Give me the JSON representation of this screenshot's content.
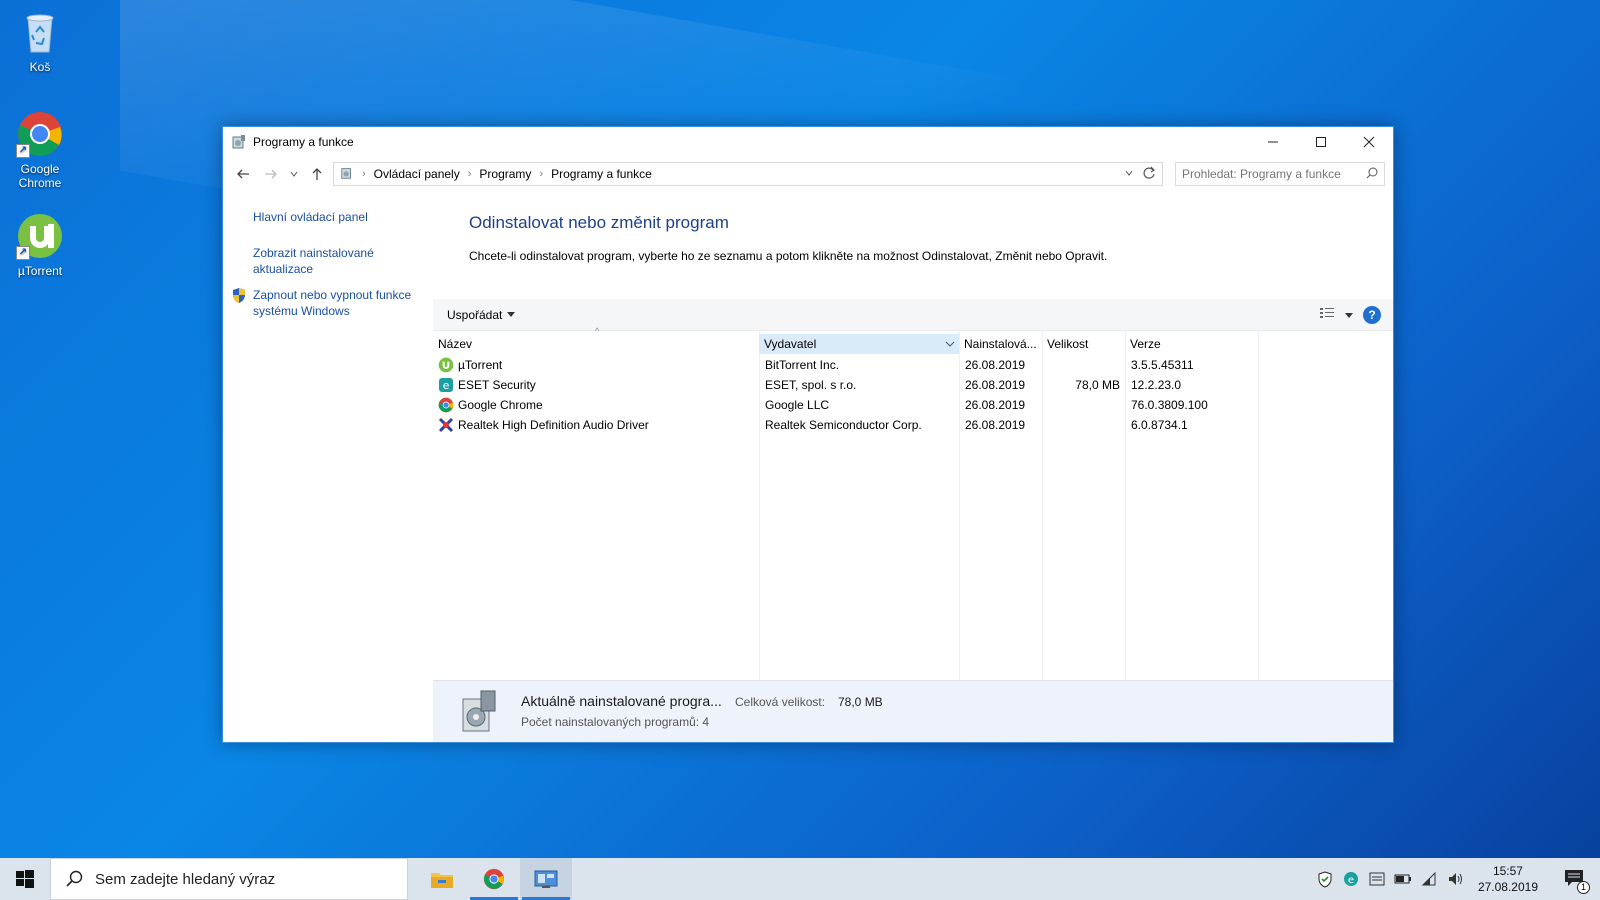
{
  "desktop": {
    "icons": [
      {
        "label": "Koš"
      },
      {
        "label": "Google Chrome"
      },
      {
        "label": "µTorrent"
      }
    ]
  },
  "window": {
    "title": "Programy a funkce",
    "controls": {
      "minimize": "—",
      "maximize": "☐",
      "close": "✕"
    },
    "breadcrumb": [
      "Ovládací panely",
      "Programy",
      "Programy a funkce"
    ],
    "search_placeholder": "Prohledat: Programy a funkce"
  },
  "left_pane": {
    "home_link": "Hlavní ovládací panel",
    "updates_link_line1": "Zobrazit nainstalované",
    "updates_link_line2": "aktualizace",
    "features_link_line1": "Zapnout nebo vypnout funkce",
    "features_link_line2": "systému Windows"
  },
  "main": {
    "heading": "Odinstalovat nebo změnit program",
    "description": "Chcete-li odinstalovat program, vyberte ho ze seznamu a potom klikněte na možnost Odinstalovat, Změnit nebo Opravit.",
    "organize_label": "Uspořádat",
    "columns": {
      "name": "Název",
      "publisher": "Vydavatel",
      "installed": "Nainstalová...",
      "size": "Velikost",
      "version": "Verze"
    },
    "programs": [
      {
        "name": "µTorrent",
        "publisher": "BitTorrent Inc.",
        "installed": "26.08.2019",
        "size": "",
        "version": "3.5.5.45311",
        "icon": "utorrent-icon"
      },
      {
        "name": "ESET Security",
        "publisher": "ESET, spol. s r.o.",
        "installed": "26.08.2019",
        "size": "78,0 MB",
        "version": "12.2.23.0",
        "icon": "eset-icon"
      },
      {
        "name": "Google Chrome",
        "publisher": "Google LLC",
        "installed": "26.08.2019",
        "size": "",
        "version": "76.0.3809.100",
        "icon": "chrome-icon"
      },
      {
        "name": "Realtek High Definition Audio Driver",
        "publisher": "Realtek Semiconductor Corp.",
        "installed": "26.08.2019",
        "size": "",
        "version": "6.0.8734.1",
        "icon": "realtek-icon"
      }
    ]
  },
  "details": {
    "title": "Aktuálně nainstalované progra...",
    "total_size_label": "Celková velikost:",
    "total_size": "78,0 MB",
    "count_text": "Počet nainstalovaných programů: 4"
  },
  "taskbar": {
    "search_placeholder": "Sem zadejte hledaný výraz",
    "time": "15:57",
    "date": "27.08.2019",
    "notification_count": "1"
  },
  "colors": {
    "accent": "#1e3f8a",
    "link": "#1a4fa0",
    "taskbar": "#dbe3ec"
  }
}
